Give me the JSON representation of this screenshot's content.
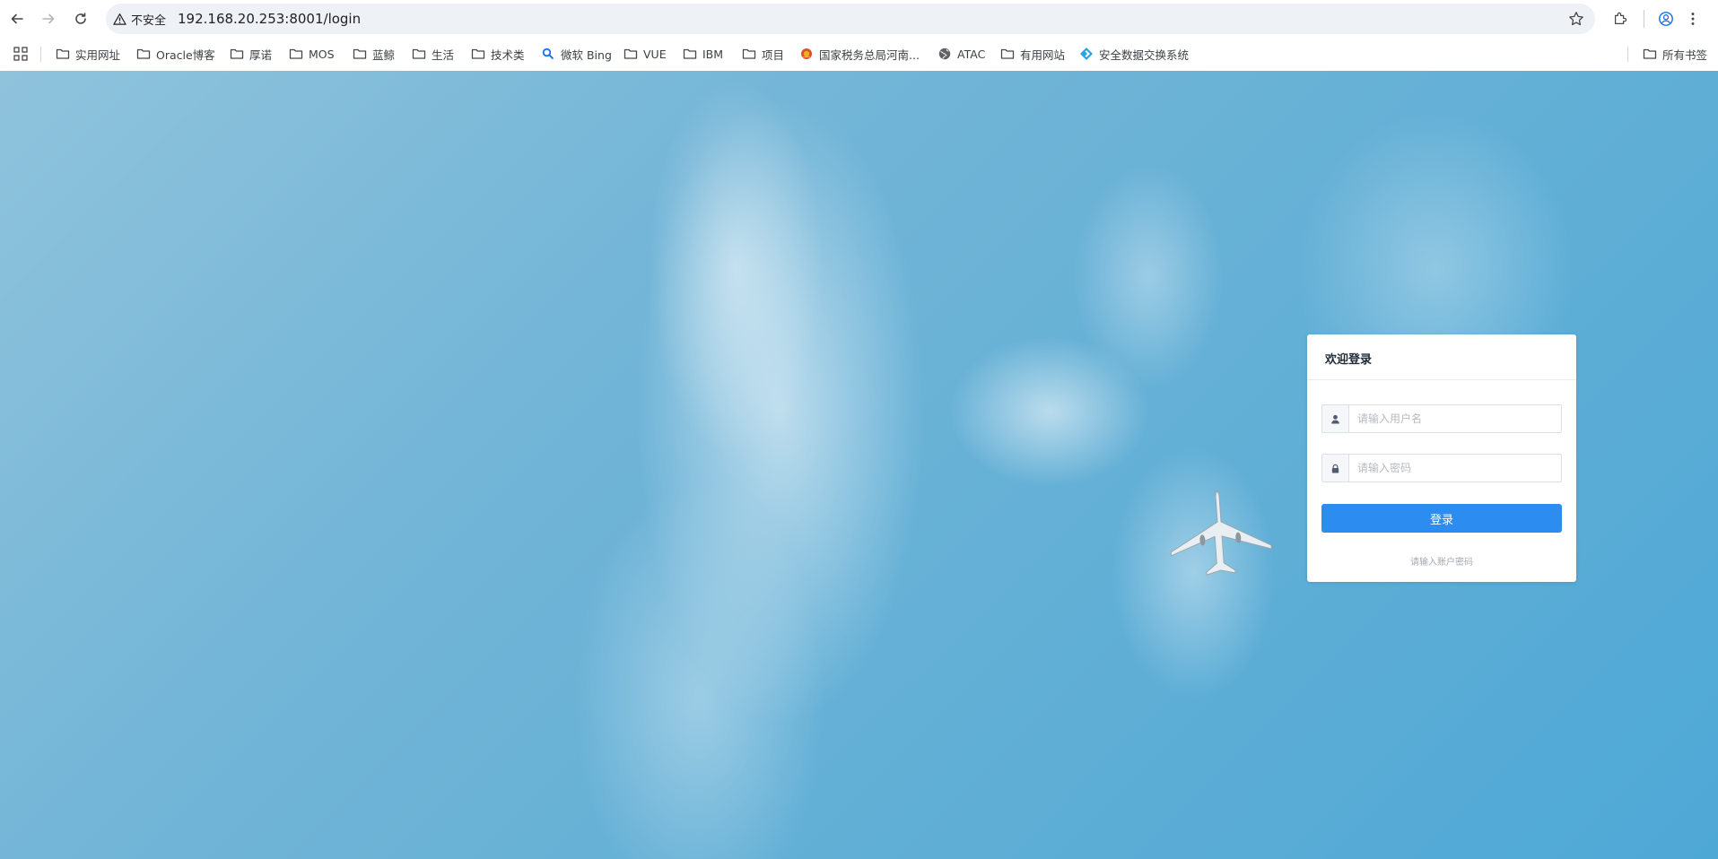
{
  "browser": {
    "security_label": "不安全",
    "url": "192.168.20.253:8001/login"
  },
  "bookmarks": {
    "items": [
      {
        "label": "实用网址",
        "icon": "folder-icon"
      },
      {
        "label": "Oracle博客",
        "icon": "folder-icon"
      },
      {
        "label": "厚诺",
        "icon": "folder-icon"
      },
      {
        "label": "MOS",
        "icon": "folder-icon"
      },
      {
        "label": "蓝鲸",
        "icon": "folder-icon"
      },
      {
        "label": "生活",
        "icon": "folder-icon"
      },
      {
        "label": "技术类",
        "icon": "folder-icon"
      },
      {
        "label": "微软 Bing",
        "icon": "bing-search-icon"
      },
      {
        "label": "VUE",
        "icon": "folder-icon"
      },
      {
        "label": "IBM",
        "icon": "folder-icon"
      },
      {
        "label": "项目",
        "icon": "folder-icon"
      },
      {
        "label": "国家税务总局河南...",
        "icon": "tax-emblem-icon"
      },
      {
        "label": "ATAC",
        "icon": "globe-icon"
      },
      {
        "label": "有用网站",
        "icon": "folder-icon"
      },
      {
        "label": "安全数据交换系统",
        "icon": "diamond-logo-icon"
      }
    ],
    "all_bookmarks": "所有书签"
  },
  "login": {
    "title": "欢迎登录",
    "username_placeholder": "请输入用户名",
    "password_placeholder": "请输入密码",
    "submit_label": "登录",
    "hint": "请输入账户密码"
  },
  "colors": {
    "primary_button": "#2d8cf0",
    "sky": "#61afd6"
  }
}
